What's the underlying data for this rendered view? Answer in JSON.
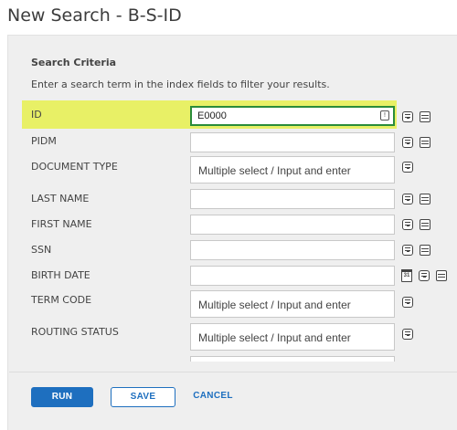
{
  "page": {
    "title": "New Search - B-S-ID"
  },
  "criteria": {
    "title": "Search Criteria",
    "description": "Enter a search term in the index fields to filter your results."
  },
  "fields": [
    {
      "label": "ID",
      "value": "E0000"
    },
    {
      "label": "PIDM",
      "value": ""
    },
    {
      "label": "DOCUMENT TYPE",
      "placeholder": "Multiple select / Input and enter"
    },
    {
      "label": "LAST NAME",
      "value": ""
    },
    {
      "label": "FIRST NAME",
      "value": ""
    },
    {
      "label": "SSN",
      "value": ""
    },
    {
      "label": "BIRTH DATE",
      "value": ""
    },
    {
      "label": "TERM CODE",
      "placeholder": "Multiple select / Input and enter"
    },
    {
      "label": "ROUTING STATUS",
      "placeholder": "Multiple select / Input and enter"
    }
  ],
  "icons": {
    "field_options": "options-icon",
    "list": "list-icon",
    "calendar": "calendar-icon",
    "calendar_day": "31",
    "id_inline": "info-icon",
    "id_inline_glyph": "!"
  },
  "highlight_color": "#e8f066",
  "accent_color": "#1e6fbf",
  "actions": {
    "run": "RUN",
    "save": "SAVE",
    "cancel": "CANCEL"
  }
}
